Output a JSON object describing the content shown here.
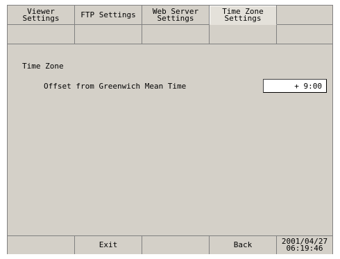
{
  "tabs": [
    {
      "label": "Viewer\nSettings",
      "active": false
    },
    {
      "label": "FTP Settings",
      "active": false
    },
    {
      "label": "Web Server\nSettings",
      "active": false
    },
    {
      "label": "Time Zone\nSettings",
      "active": true
    },
    {
      "label": "",
      "active": false
    }
  ],
  "content": {
    "section_title": "Time Zone",
    "offset_label": "Offset from Greenwich Mean Time",
    "offset_value": "+ 9:00"
  },
  "bottom_bar": {
    "exit_label": "Exit",
    "back_label": "Back",
    "datetime": "2001/04/27\n06:19:46"
  },
  "colors": {
    "panel": "#d4d0c8",
    "border": "#808080",
    "field": "#ffffff"
  }
}
